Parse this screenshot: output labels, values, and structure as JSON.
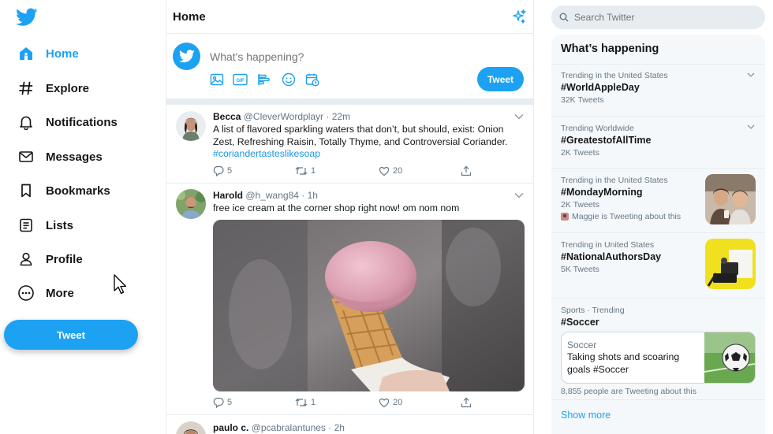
{
  "nav": {
    "items": [
      {
        "label": "Home",
        "icon": "home-icon",
        "active": true
      },
      {
        "label": "Explore",
        "icon": "hashtag-icon"
      },
      {
        "label": "Notifications",
        "icon": "bell-icon"
      },
      {
        "label": "Messages",
        "icon": "envelope-icon"
      },
      {
        "label": "Bookmarks",
        "icon": "bookmark-icon"
      },
      {
        "label": "Lists",
        "icon": "list-icon"
      },
      {
        "label": "Profile",
        "icon": "person-icon"
      },
      {
        "label": "More",
        "icon": "more-circle-icon"
      }
    ],
    "tweet_button": "Tweet"
  },
  "timeline": {
    "title": "Home",
    "composer": {
      "placeholder": "What's happening?",
      "tweet_button": "Tweet",
      "tools": [
        "image-icon",
        "gif-icon",
        "poll-icon",
        "emoji-icon",
        "schedule-icon"
      ]
    },
    "tweets": [
      {
        "name": "Becca",
        "handle": "@CleverWordplayr",
        "time": "· 22m",
        "text": "A list of flavored sparkling waters that don’t, but should, exist: Onion Zest, Refreshing Raisin, Totally Thyme, and Controversial Coriander.",
        "hashtag": "#coriandertasteslikesoap",
        "replies": "5",
        "retweets": "1",
        "likes": "20"
      },
      {
        "name": "Harold",
        "handle": "@h_wang84",
        "time": "· 1h",
        "text": "free ice cream at the corner shop right now! om nom nom",
        "replies": "5",
        "retweets": "1",
        "likes": "20"
      },
      {
        "name": "paulo c.",
        "handle": "@pcabralantunes",
        "time": "· 2h"
      }
    ]
  },
  "sidebar": {
    "search_placeholder": "Search Twitter",
    "trends_title": "What’s happening",
    "trends": [
      {
        "context": "Trending in the United States",
        "tag": "#WorldAppleDay",
        "count": "32K Tweets"
      },
      {
        "context": "Trending Worldwide",
        "tag": "#GreatestofAllTime",
        "count": "2K Tweets"
      },
      {
        "context": "Trending in the United States",
        "tag": "#MondayMorning",
        "count": "2K Tweets",
        "extra": "Maggie is Tweeting about this"
      },
      {
        "context": "Trending in United States",
        "tag": "#NationalAuthorsDay",
        "count": "5K Tweets"
      },
      {
        "context": "Sports · Trending",
        "tag": "#Soccer",
        "card_title": "Soccer",
        "card_text": "Taking shots and scoaring goals #Soccer",
        "count": "8,855 people are Tweeting about this"
      }
    ],
    "show_more": "Show more"
  },
  "colors": {
    "accent": "#1da1f2",
    "text": "#14171a",
    "muted": "#657786",
    "border": "#e6ecf0"
  }
}
